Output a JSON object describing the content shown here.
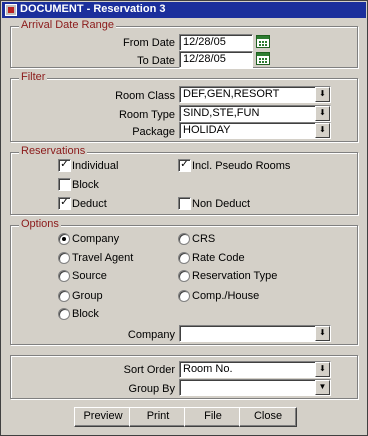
{
  "window": {
    "title": "DOCUMENT - Reservation 3"
  },
  "arrival": {
    "section_title": "Arrival Date Range",
    "from_label": "From Date",
    "from_value": "12/28/05",
    "to_label": "To Date",
    "to_value": "12/28/05"
  },
  "filter": {
    "section_title": "Filter",
    "room_class_label": "Room Class",
    "room_class_value": "DEF,GEN,RESORT",
    "room_type_label": "Room Type",
    "room_type_value": "SIND,STE,FUN",
    "package_label": "Package",
    "package_value": "HOLIDAY"
  },
  "reservations": {
    "section_title": "Reservations",
    "items": [
      {
        "label": "Individual",
        "checked": true
      },
      {
        "label": "Incl. Pseudo Rooms",
        "checked": true
      },
      {
        "label": "Block",
        "checked": false
      },
      {
        "label": "Deduct",
        "checked": true
      },
      {
        "label": "Non Deduct",
        "checked": false
      }
    ]
  },
  "options": {
    "section_title": "Options",
    "radios": [
      {
        "label": "Company",
        "selected": true
      },
      {
        "label": "CRS",
        "selected": false
      },
      {
        "label": "Travel Agent",
        "selected": false
      },
      {
        "label": "Rate Code",
        "selected": false
      },
      {
        "label": "Source",
        "selected": false
      },
      {
        "label": "Reservation Type",
        "selected": false
      },
      {
        "label": "Group",
        "selected": false
      },
      {
        "label": "Comp./House",
        "selected": false
      },
      {
        "label": "Block",
        "selected": false
      }
    ],
    "company_label": "Company",
    "company_value": ""
  },
  "sorting": {
    "sort_order_label": "Sort Order",
    "sort_order_value": "Room No.",
    "group_by_label": "Group By",
    "group_by_value": ""
  },
  "buttons": {
    "preview": "Preview",
    "print": "Print",
    "file": "File",
    "close": "Close"
  },
  "icons": {
    "calendar": "calendar-icon",
    "dropdown": "dropdown-arrow-icon",
    "checkmark": "✓"
  },
  "colors": {
    "title_bar": "#1b2f9c",
    "section_title": "#8b1a1a",
    "window_bg": "#d4d0c8"
  }
}
